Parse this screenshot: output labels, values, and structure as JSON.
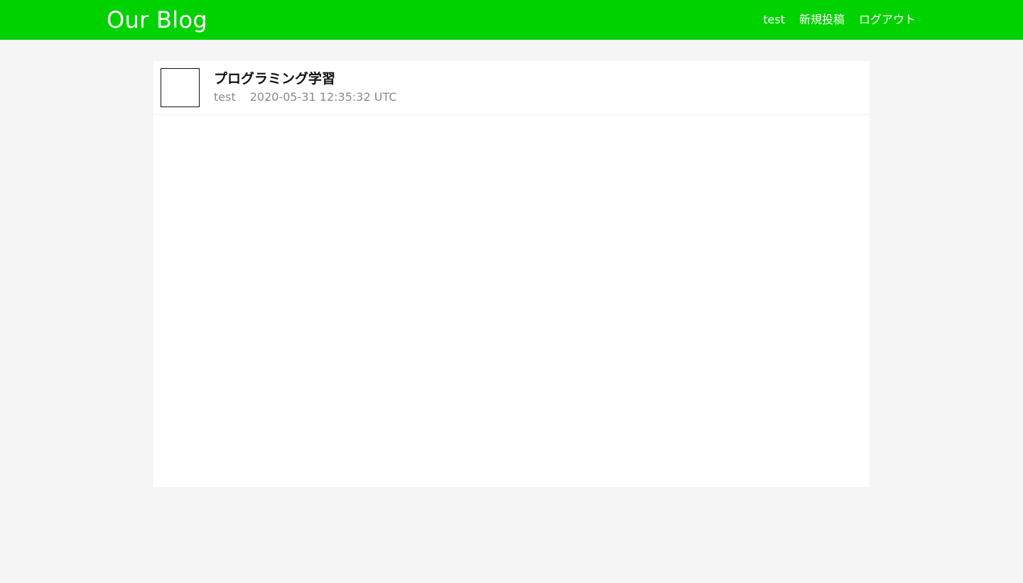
{
  "header": {
    "brand": "Our Blog",
    "nav": [
      {
        "label": "test"
      },
      {
        "label": "新規投稿"
      },
      {
        "label": "ログアウト"
      }
    ]
  },
  "post": {
    "title": "プログラミング学習",
    "author": "test",
    "timestamp": "2020-05-31 12:35:32 UTC",
    "body": ""
  },
  "colors": {
    "header_bg": "#00d200",
    "page_bg": "#f5f5f5",
    "card_bg": "#ffffff",
    "meta_text": "#8a8a8a"
  },
  "icons": {
    "avatar": "user-avatar-placeholder"
  }
}
